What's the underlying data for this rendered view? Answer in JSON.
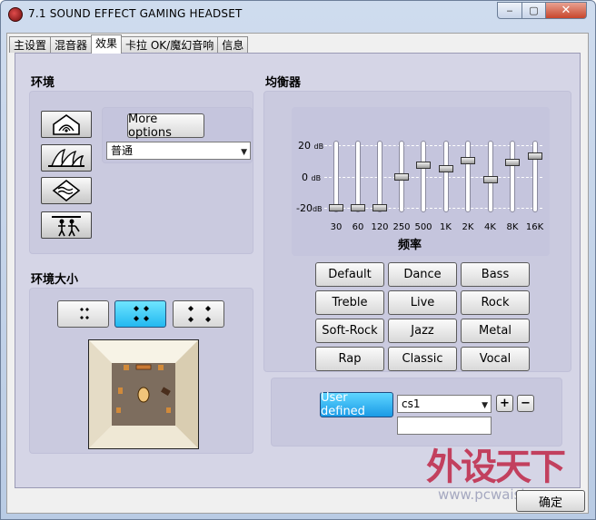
{
  "window": {
    "title": "7.1 SOUND EFFECT GAMING HEADSET",
    "min": "‒",
    "max": "▢",
    "close": "✕"
  },
  "tabs": [
    {
      "label": "主设置",
      "active": false
    },
    {
      "label": "混音器",
      "active": false
    },
    {
      "label": "效果",
      "active": true
    },
    {
      "label": "卡拉 OK/魔幻音响",
      "active": false
    },
    {
      "label": "信息",
      "active": false
    }
  ],
  "environment": {
    "heading": "环境",
    "icons": [
      "room-icon",
      "opera-house-icon",
      "underwater-icon",
      "concert-icon"
    ],
    "more_options": "More options",
    "preset_value": "普通"
  },
  "env_size": {
    "heading": "环境大小",
    "buttons": [
      "size-small-icon",
      "size-medium-icon",
      "size-large-icon"
    ],
    "selected": 1
  },
  "equalizer": {
    "heading": "均衡器",
    "db_labels": [
      "20",
      "0",
      "-20"
    ],
    "db_unit": "dB",
    "freq_title": "频率",
    "bands": [
      {
        "freq": "30",
        "level": -20
      },
      {
        "freq": "60",
        "level": -20
      },
      {
        "freq": "120",
        "level": -20
      },
      {
        "freq": "250",
        "level": 0
      },
      {
        "freq": "500",
        "level": 7
      },
      {
        "freq": "1K",
        "level": 5
      },
      {
        "freq": "2K",
        "level": 10
      },
      {
        "freq": "4K",
        "level": -2
      },
      {
        "freq": "8K",
        "level": 9
      },
      {
        "freq": "16K",
        "level": 13
      }
    ],
    "presets": [
      "Default",
      "Dance",
      "Bass",
      "Treble",
      "Live",
      "Rock",
      "Soft-Rock",
      "Jazz",
      "Metal",
      "Rap",
      "Classic",
      "Vocal"
    ],
    "user_defined": "User defined",
    "user_preset_value": "cs1",
    "add": "+",
    "remove": "−",
    "name_value": ""
  },
  "ok_button": "确定",
  "watermark": {
    "text": "外设天下",
    "url": "www.pcwaishe.cn"
  }
}
